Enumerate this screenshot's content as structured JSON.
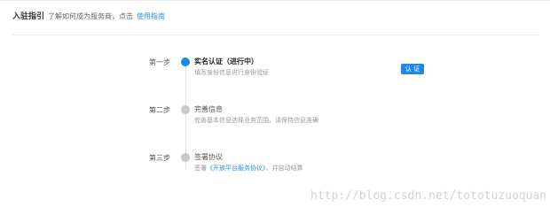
{
  "header": {
    "title": "入驻指引",
    "desc": "了解如何成为服务商，点击",
    "link": "使用指南"
  },
  "steps": [
    {
      "label": "第一步",
      "name": "实名认证（进行中）",
      "sub": "填写身份信息进行身份验证",
      "state": "active"
    },
    {
      "label": "第二步",
      "name": "完善信息",
      "sub": "完善基本信息选择业务范围，请保持信息准确",
      "state": "pending"
    },
    {
      "label": "第三步",
      "name": "签署协议",
      "sub_prefix": "签署",
      "sub_link": "《开放平台服务协议》",
      "sub_suffix": "，并自动结算",
      "state": "pending"
    }
  ],
  "auth_button": "认 证",
  "watermark": "http://blog.csdn.net/tototuzuoquan",
  "colors": {
    "accent": "#1e88e5",
    "inactive_dot": "#c9c9c9"
  }
}
